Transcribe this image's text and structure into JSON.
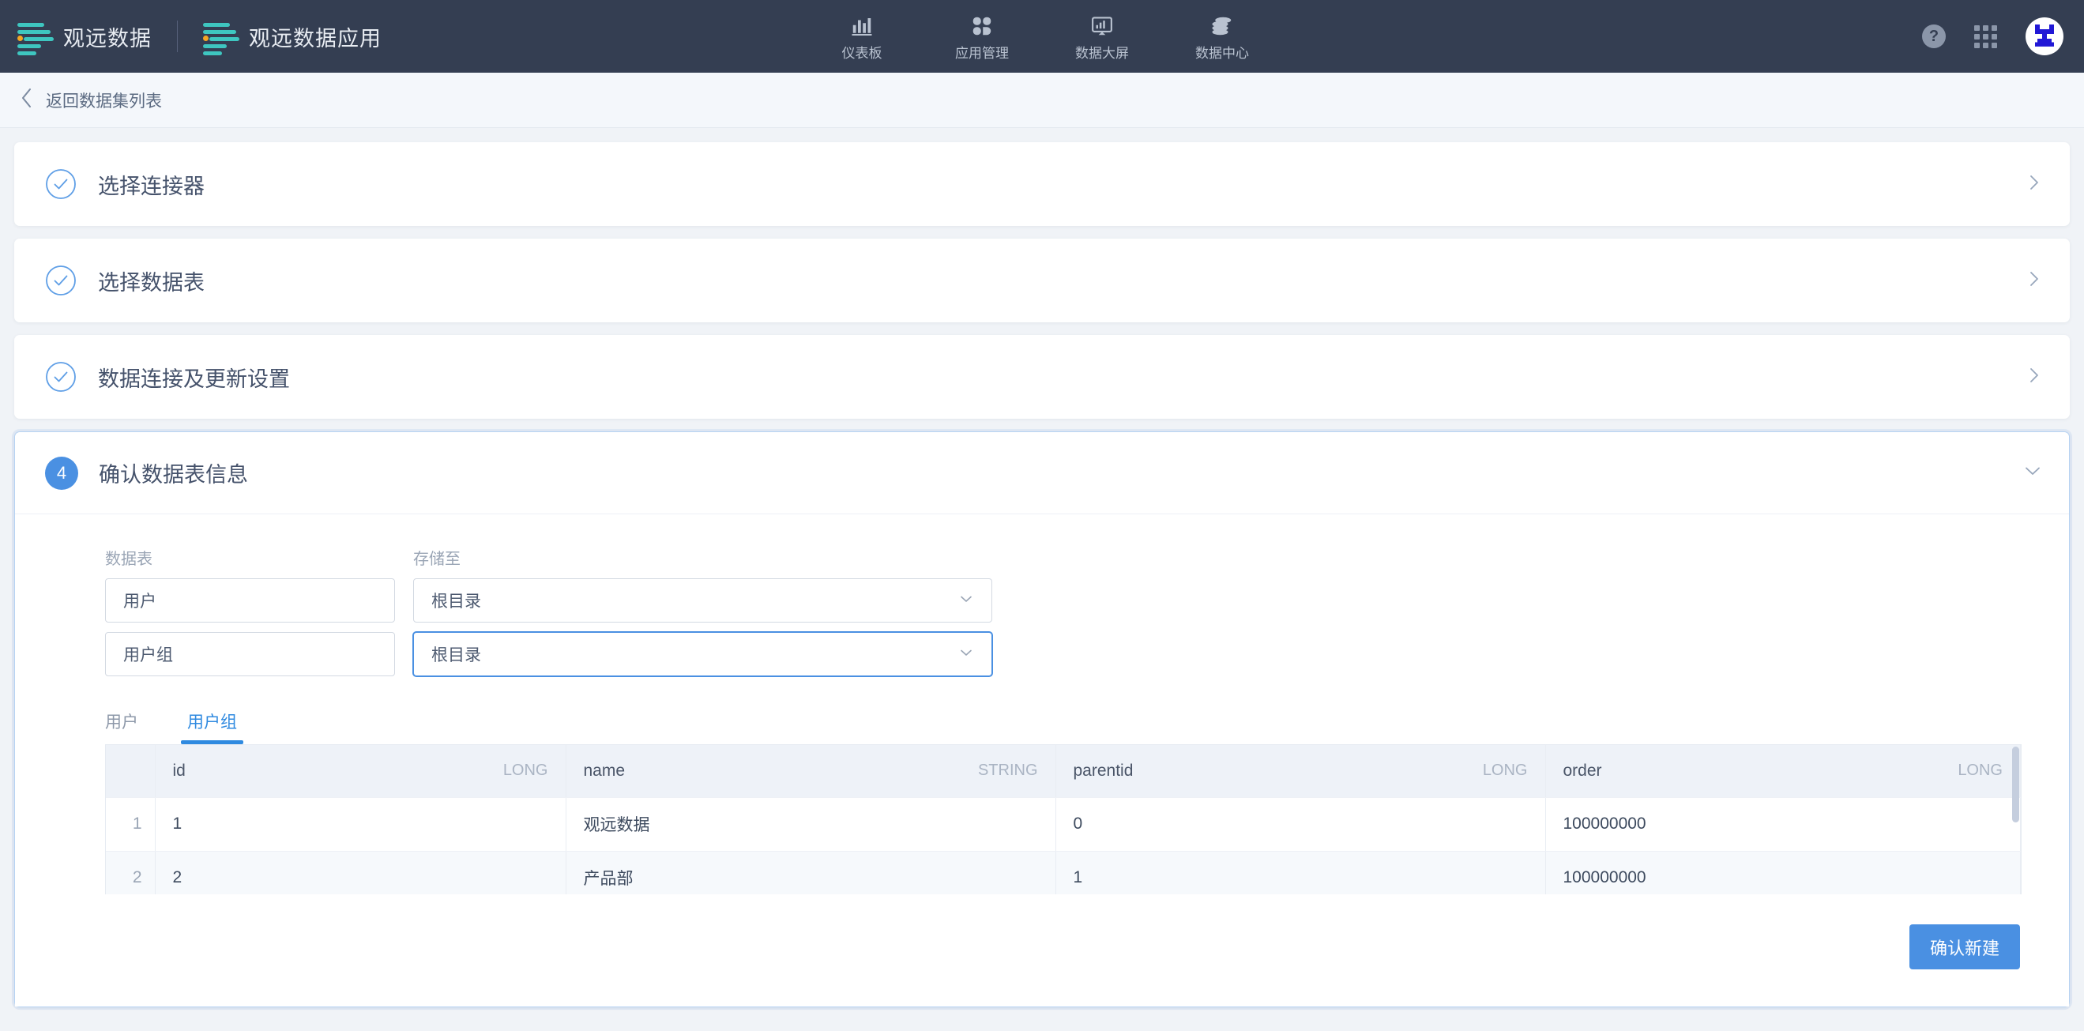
{
  "header": {
    "brand": {
      "name": "观远数据",
      "logo_icon": "guandata-bars-logo"
    },
    "product": {
      "name": "观远数据应用",
      "logo_icon": "guandata-bars-logo"
    },
    "nav": [
      {
        "label": "仪表板",
        "icon": "bar-chart-icon"
      },
      {
        "label": "应用管理",
        "icon": "clover-apps-icon"
      },
      {
        "label": "数据大屏",
        "icon": "screen-monitor-icon"
      },
      {
        "label": "数据中心",
        "icon": "database-stack-icon"
      }
    ],
    "actions": {
      "help": "?",
      "help_icon": "help-question-icon",
      "apps_icon": "apps-grid-icon",
      "avatar_icon": "user-avatar"
    }
  },
  "breadcrumb": {
    "back_label": "返回数据集列表",
    "back_icon": "chevron-left-icon"
  },
  "steps": [
    {
      "title": "选择连接器",
      "state": "done",
      "badge_icon": "check-circle-icon",
      "chevron": "chevron-right-icon"
    },
    {
      "title": "选择数据表",
      "state": "done",
      "badge_icon": "check-circle-icon",
      "chevron": "chevron-right-icon"
    },
    {
      "title": "数据连接及更新设置",
      "state": "done",
      "badge_icon": "check-circle-icon",
      "chevron": "chevron-right-icon"
    },
    {
      "title": "确认数据表信息",
      "state": "active",
      "badge_number": "4",
      "chevron": "chevron-down-icon"
    }
  ],
  "form": {
    "labels": {
      "table": "数据表",
      "storage": "存储至"
    },
    "rows": [
      {
        "table_name": "用户",
        "storage": "根目录",
        "focused": false
      },
      {
        "table_name": "用户组",
        "storage": "根目录",
        "focused": true
      }
    ],
    "dropdown_icon": "chevron-down-icon"
  },
  "tabs": [
    {
      "label": "用户",
      "active": false
    },
    {
      "label": "用户组",
      "active": true
    }
  ],
  "table": {
    "columns": [
      {
        "name": "id",
        "type": "LONG"
      },
      {
        "name": "name",
        "type": "STRING"
      },
      {
        "name": "parentid",
        "type": "LONG"
      },
      {
        "name": "order",
        "type": "LONG"
      }
    ],
    "rows": [
      {
        "index": "1",
        "cells": [
          "1",
          "观远数据",
          "0",
          "100000000"
        ]
      },
      {
        "index": "2",
        "cells": [
          "2",
          "产品部",
          "1",
          "100000000"
        ]
      }
    ],
    "scrollbar": "vertical-scrollbar"
  },
  "footer": {
    "confirm_label": "确认新建"
  },
  "colors": {
    "nav_bg": "#343e52",
    "accent": "#4a90e2",
    "brand_teal": "#3ec6c0",
    "brand_orange": "#f5a623",
    "page_bg": "#f0f3f7"
  }
}
